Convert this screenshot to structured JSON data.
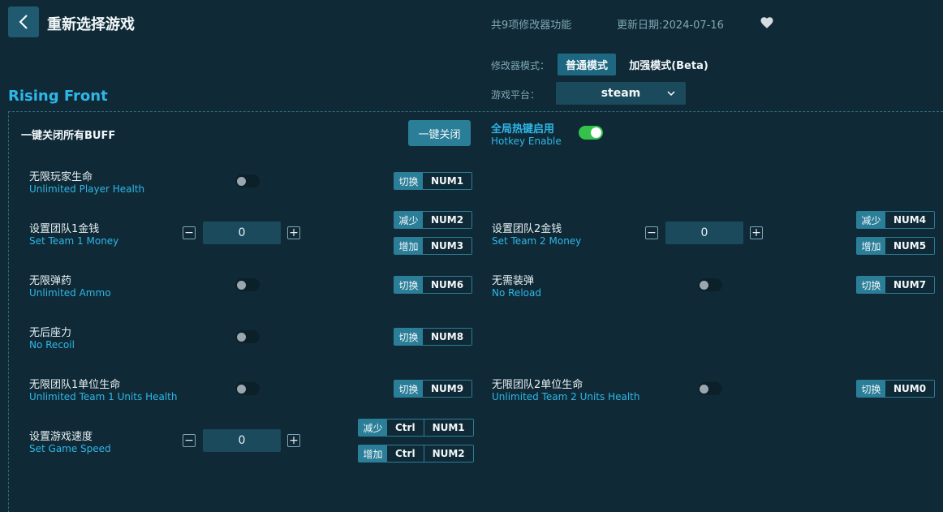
{
  "header": {
    "title": "重新选择游戏",
    "feature_count": "共9项修改器功能",
    "update_date": "更新日期:2024-07-16"
  },
  "mode": {
    "label": "修改器模式：",
    "normal": "普通模式",
    "beta": "加强模式(Beta)"
  },
  "platform": {
    "label": "游戏平台：",
    "value": "steam"
  },
  "game_title": "Rising Front",
  "global": {
    "all_off_label": "一键关闭所有BUFF",
    "all_off_button": "一键关闭",
    "hotkey_cn": "全局热键启用",
    "hotkey_en": "Hotkey Enable"
  },
  "tags": {
    "toggle": "切换",
    "decrease": "减少",
    "increase": "增加"
  },
  "features": {
    "player_health": {
      "cn": "无限玩家生命",
      "en": "Unlimited Player Health",
      "key": "NUM1"
    },
    "team1_money": {
      "cn": "设置团队1金钱",
      "en": "Set Team 1 Money",
      "value": "0",
      "dec_key": "NUM2",
      "inc_key": "NUM3"
    },
    "team2_money": {
      "cn": "设置团队2金钱",
      "en": "Set Team 2 Money",
      "value": "0",
      "dec_key": "NUM4",
      "inc_key": "NUM5"
    },
    "ammo": {
      "cn": "无限弹药",
      "en": "Unlimited Ammo",
      "key": "NUM6"
    },
    "no_reload": {
      "cn": "无需装弹",
      "en": "No Reload",
      "key": "NUM7"
    },
    "no_recoil": {
      "cn": "无后座力",
      "en": "No Recoil",
      "key": "NUM8"
    },
    "team1_units": {
      "cn": "无限团队1单位生命",
      "en": "Unlimited Team 1 Units Health",
      "key": "NUM9"
    },
    "team2_units": {
      "cn": "无限团队2单位生命",
      "en": "Unlimited Team 2 Units Health",
      "key": "NUM0"
    },
    "game_speed": {
      "cn": "设置游戏速度",
      "en": "Set Game Speed",
      "value": "0",
      "mod": "Ctrl",
      "dec_key": "NUM1",
      "inc_key": "NUM2"
    }
  },
  "stepper": {
    "minus": "−",
    "plus": "+"
  }
}
